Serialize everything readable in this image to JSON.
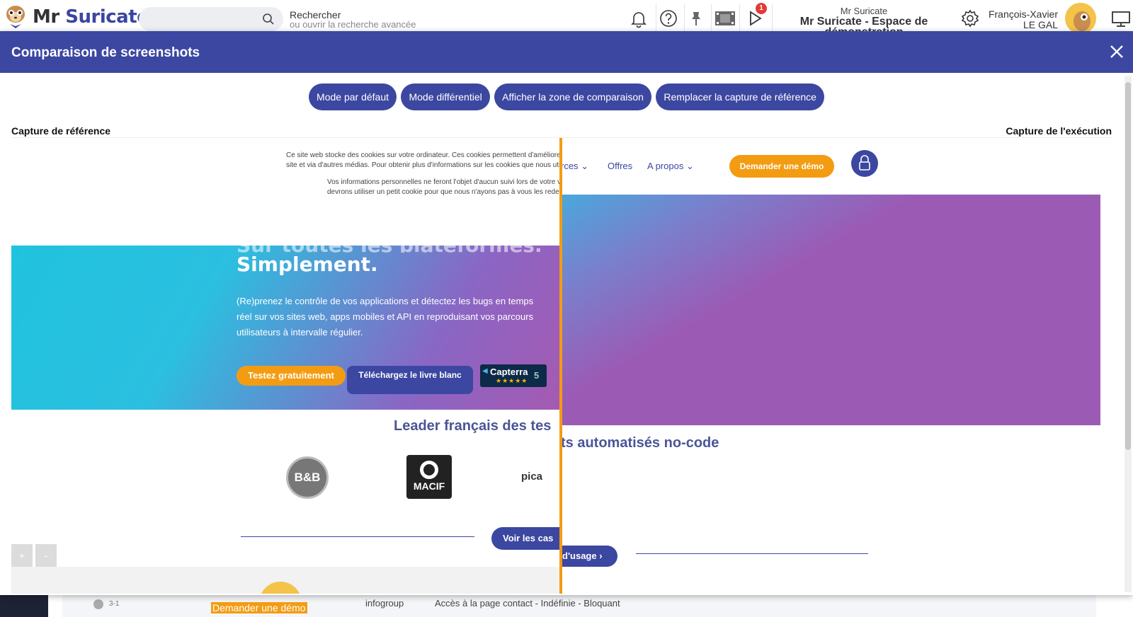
{
  "app": {
    "brand_mr": "Mr",
    "brand_name": "Suricate",
    "search_title": "Rechercher",
    "search_subtitle": "ou ouvrir la recherche avancée",
    "notification_count": "1",
    "space_owner": "Mr Suricate",
    "space_name": "Mr Suricate - Espace de démonstration",
    "user_first": "François-Xavier",
    "user_last": "LE GAL"
  },
  "background_row": {
    "id": "3-1",
    "col1": "Demander une démo",
    "col2": "infogroup",
    "col3": "Accès à la page contact - Indéfinie - Bloquant"
  },
  "modal": {
    "title": "Comparaison de screenshots",
    "modes": [
      "Mode par défaut",
      "Mode différentiel",
      "Afficher la zone de comparaison",
      "Remplacer la capture de référence"
    ],
    "label_reference": "Capture de référence",
    "label_execution": "Capture de l'exécution",
    "zoom_in": "+",
    "zoom_out": "-"
  },
  "reference": {
    "cookie_1": "Ce site web stocke des cookies sur votre ordinateur. Ces cookies permettent d'améliorer v",
    "cookie_2": "site et via d'autres médias. Pour obtenir plus d'informations sur les cookies que nous utilis",
    "cookie_3": "Vos informations personnelles ne feront l'objet d'aucun suivi lors de votre vis",
    "cookie_4": "devrons utiliser un petit cookie pour que nous n'ayons pas à vous les redema",
    "hero_ghost": "Sur toutes les plateformes.",
    "hero_title": "Simplement.",
    "hero_text": "(Re)prenez le contrôle de vos applications et détectez les bugs en temps réel sur vos sites web, apps mobiles et API en reproduisant vos parcours utilisateurs à intervalle régulier.",
    "btn_try": "Testez gratuitement",
    "btn_download": "Téléchargez le livre blanc",
    "capterra": "Capterra",
    "capterra_stars": "★★★★★",
    "capterra_score": "5",
    "leader": "Leader français des tes",
    "logo_bb": "B&B",
    "logo_macif": "MACIF",
    "logo_pica": "pica",
    "btn_cases": "Voir les cas"
  },
  "execution": {
    "nav_ressources": "rces",
    "nav_offres": "Offres",
    "nav_apropos": "A propos",
    "btn_demo": "Demander une démo",
    "leader": "ts automatisés no-code",
    "btn_usage": "d'usage"
  }
}
